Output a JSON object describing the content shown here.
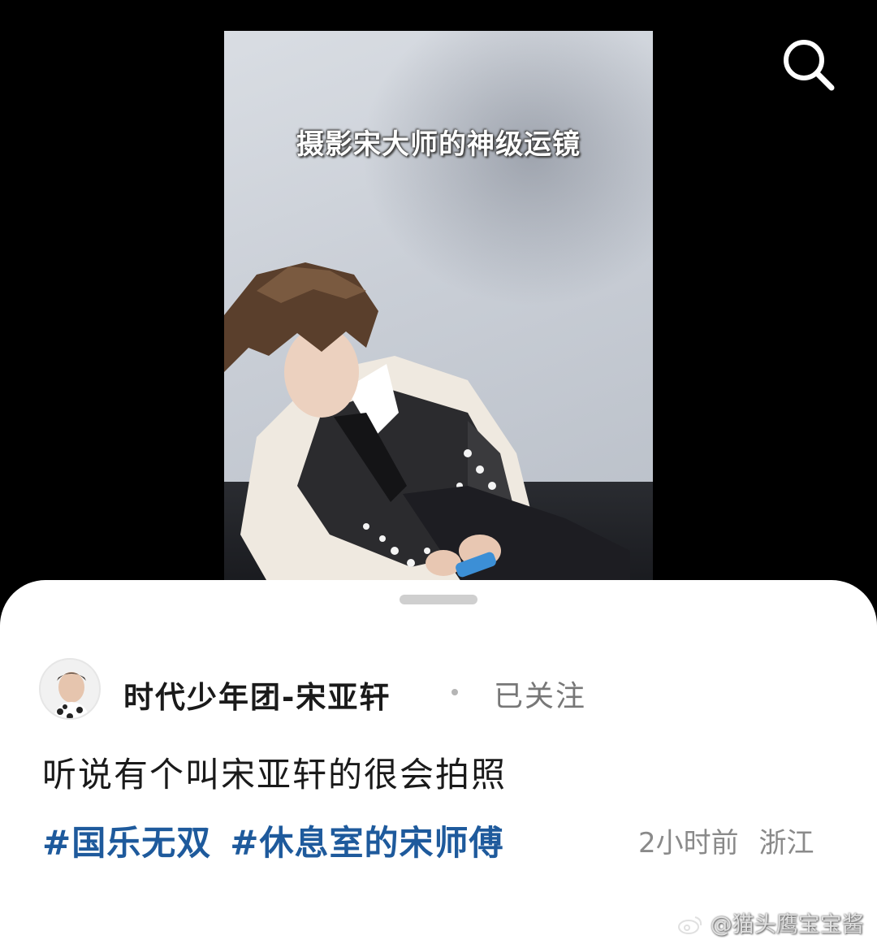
{
  "video": {
    "caption": "摄影宋大师的神级运镜"
  },
  "toolbar": {
    "search_icon": "search-icon"
  },
  "post": {
    "author": {
      "name": "时代少年团-宋亚轩",
      "follow_status": "已关注"
    },
    "text": "听说有个叫宋亚轩的很会拍照",
    "hashtags": [
      "#国乐无双",
      "#休息室的宋师傅"
    ],
    "time": "2小时前",
    "location": "浙江"
  },
  "watermark": {
    "text": "@猫头鹰宝宝酱"
  },
  "colors": {
    "hashtag": "#1e5a9c",
    "background": "#000000",
    "sheet": "#ffffff"
  }
}
